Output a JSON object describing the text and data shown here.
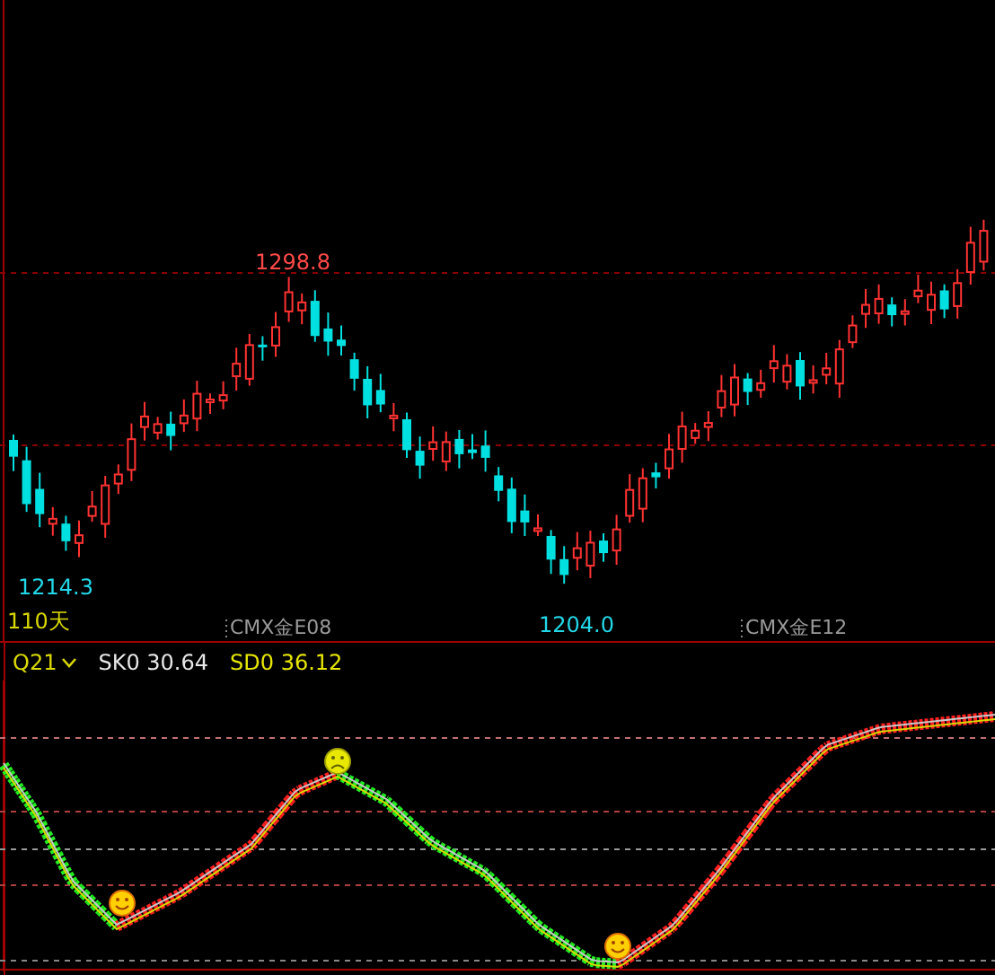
{
  "price_chart": {
    "price_labels": [
      {
        "text": "1298.8",
        "kind": "high"
      },
      {
        "text": "1214.3",
        "kind": "low"
      },
      {
        "text": "1204.0",
        "kind": "low"
      }
    ],
    "period": "110天",
    "date_markers": [
      "CMX金E08",
      "CMX金E12"
    ]
  },
  "indicator": {
    "name": "Q21",
    "params": [
      {
        "label": "SK0 30.64",
        "color": "#e8e8e8"
      },
      {
        "label": "SD0 36.12",
        "color": "#e6e600"
      }
    ]
  }
}
